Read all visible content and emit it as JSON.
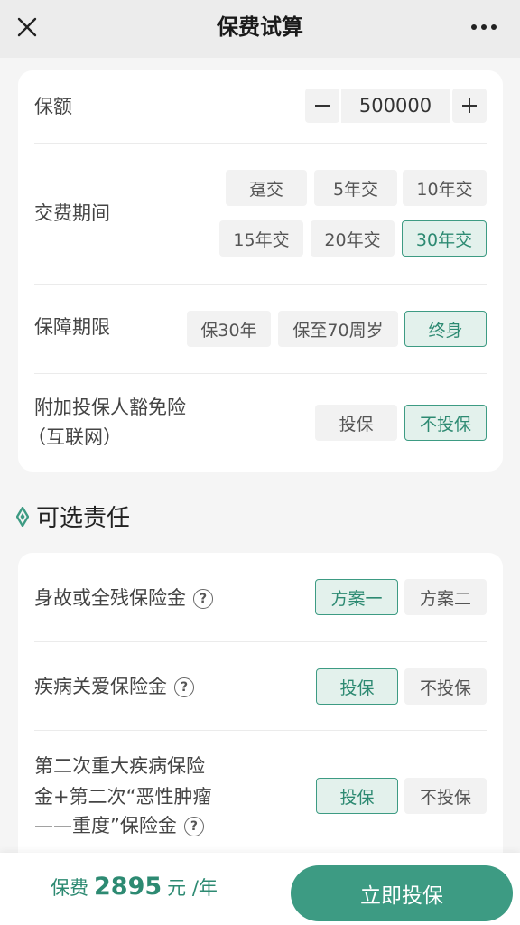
{
  "header": {
    "title": "保费试算",
    "close_icon": "close-icon",
    "more_icon": "more-icon"
  },
  "coverage_amount": {
    "label": "保额",
    "value": "500000",
    "minus_label": "−",
    "plus_label": "+"
  },
  "payment_period": {
    "label": "交费期间",
    "options": [
      "趸交",
      "5年交",
      "10年交",
      "15年交",
      "20年交",
      "30年交"
    ],
    "selected": "30年交"
  },
  "coverage_term": {
    "label": "保障期限",
    "options": [
      "保30年",
      "保至70周岁",
      "终身"
    ],
    "selected": "终身"
  },
  "waiver": {
    "label_line1": "附加投保人豁免险",
    "label_line2": "（互联网）",
    "options": [
      "投保",
      "不投保"
    ],
    "selected": "不投保"
  },
  "optional_section": {
    "title": "可选责任"
  },
  "optional_items": [
    {
      "label": "身故或全残保险金",
      "help": "?",
      "options": [
        "方案一",
        "方案二"
      ],
      "selected": "方案一"
    },
    {
      "label": "疾病关爱保险金",
      "help": "?",
      "options": [
        "投保",
        "不投保"
      ],
      "selected": "投保"
    },
    {
      "label_line1": "第二次重大疾病保险",
      "label_line2": "金+第二次“恶性肿瘤",
      "label_line3": "——重度”保险金",
      "help": "?",
      "options": [
        "投保",
        "不投保"
      ],
      "selected": "投保"
    }
  ],
  "footer": {
    "premium_label": "保费",
    "premium_amount": "2895",
    "premium_unit": "元 /年",
    "buy_label": "立即投保"
  },
  "colors": {
    "accent": "#3d9b83",
    "selected_bg": "#e3f1ec",
    "option_bg": "#f2f2f2"
  }
}
